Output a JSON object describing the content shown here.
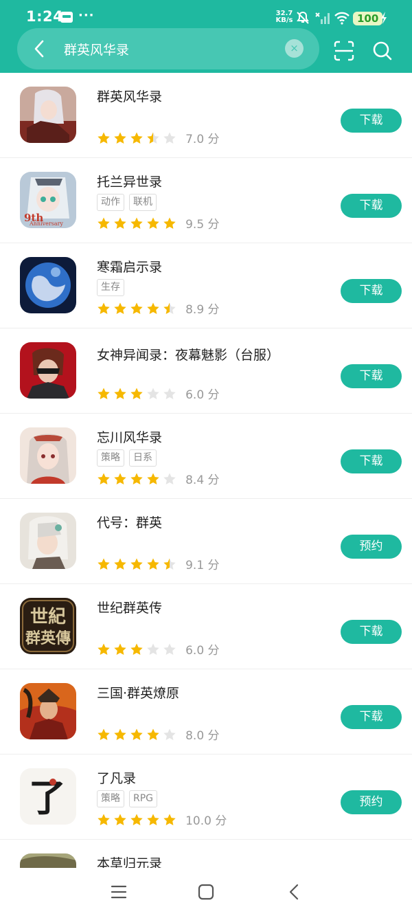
{
  "status_bar": {
    "time": "1:24",
    "more": "···",
    "speed_value": "32.7",
    "speed_unit": "KB/s",
    "battery": "100",
    "icons": [
      "notification-icon",
      "mute-icon",
      "signal-icon",
      "wifi-icon",
      "battery-icon",
      "charging-icon"
    ]
  },
  "search": {
    "query": "群英风华录",
    "clear_label": "×"
  },
  "colors": {
    "accent": "#1fb9a0",
    "star": "#f6b800",
    "star_empty": "#e4e4e4"
  },
  "apps": [
    {
      "name": "群英风华录",
      "tags": [],
      "rating": 3.5,
      "score": "7.0 分",
      "action": "下载"
    },
    {
      "name": "托兰异世录",
      "tags": [
        "动作",
        "联机"
      ],
      "rating": 5,
      "score": "9.5 分",
      "action": "下载"
    },
    {
      "name": "寒霜启示录",
      "tags": [
        "生存"
      ],
      "rating": 4.5,
      "score": "8.9 分",
      "action": "下载"
    },
    {
      "name": "女神异闻录：夜幕魅影（台服）",
      "tags": [],
      "rating": 3,
      "score": "6.0 分",
      "action": "下载"
    },
    {
      "name": "忘川风华录",
      "tags": [
        "策略",
        "日系"
      ],
      "rating": 4,
      "score": "8.4 分",
      "action": "下载"
    },
    {
      "name": "代号：群英",
      "tags": [],
      "rating": 4.5,
      "score": "9.1 分",
      "action": "预约"
    },
    {
      "name": "世纪群英传",
      "tags": [],
      "rating": 3,
      "score": "6.0 分",
      "action": "下载"
    },
    {
      "name": "三国·群英燎原",
      "tags": [],
      "rating": 4,
      "score": "8.0 分",
      "action": "下载"
    },
    {
      "name": "了凡录",
      "tags": [
        "策略",
        "RPG"
      ],
      "rating": 5,
      "score": "10.0 分",
      "action": "预约"
    },
    {
      "name": "本草归元录",
      "tags": [],
      "rating": null,
      "score": "",
      "action": ""
    }
  ],
  "icon_art": {
    "app2_badge": "9th",
    "app2_badge_sub": "Anniversary",
    "app7_line1": "世紀",
    "app7_line2": "群英傳",
    "app9_glyph": "了"
  },
  "nav": {
    "icons": [
      "menu-icon",
      "home-icon",
      "back-icon"
    ]
  }
}
